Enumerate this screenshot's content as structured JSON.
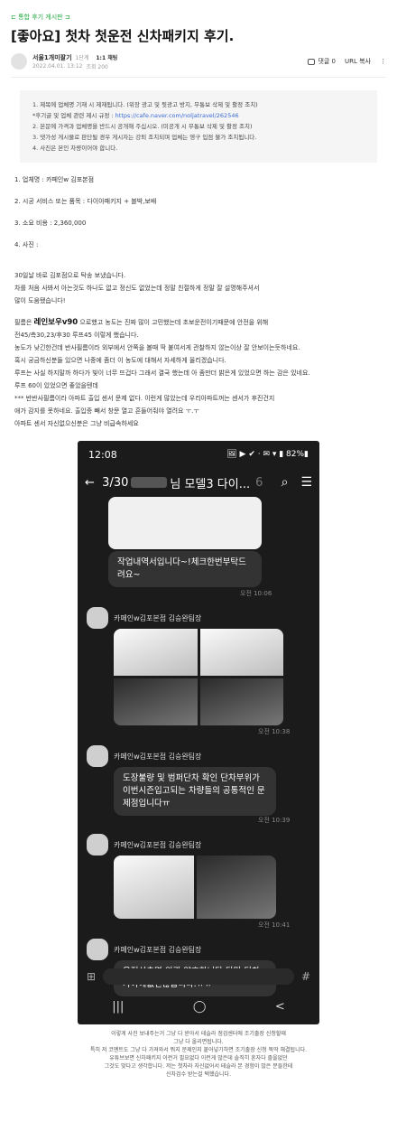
{
  "header": {
    "board_link": "⊏ 통합 후기 게시판 ⊐",
    "title": "[좋아요] 첫차 첫운전 신차패키지 후기."
  },
  "author": {
    "name": "서울1개미팔기",
    "level": "1단계",
    "chat": "1:1 채팅",
    "date": "2022.04.01. 13:12",
    "views": "조회 200"
  },
  "actions": {
    "comments": "댓글 0",
    "url": "URL 복사",
    "more": "⋮"
  },
  "notice": {
    "lines": [
      "1. 제목에 업체명 기재 시 제재됩니다. (위장 광고 및 뒷광고 방지, 무통보 삭제 및 활정 조치)",
      "*후기글 및 업체 관련 제시 규정 : ",
      "2. 본문에 가격과 업체명을 반드시 공개해 주십시오. (미공개 시 무통보 삭제 및 활정 조치)",
      "3. 댓가성 게시물로 판단될 경우 게시자는 강퇴 조치되며 업체는 영구 입점 불가 조치됩니다.",
      "4. 사진은 본인 차량이어야 합니다."
    ],
    "link": "https://cafe.naver.com/noljatravel/262546"
  },
  "body": {
    "items": [
      "1. 업체명 :  카페인w 김포본점",
      "2. 시공 서비스 또는 품목 :  다이아패키지 + 블박,보배",
      "3. 소요 비용 :  2,360,000",
      "4. 사진 :"
    ],
    "para1": [
      " 30일날 바로 김포점으로 탁송 보냈습니다.",
      "차를 처음 사봐서 아는것도 하나도 없고 정신도 없었는데 정말 친절하게 정말 잘 설명해주셔서",
      "많이 도움됐습니다!"
    ],
    "rain_prefix": "필름은 ",
    "rain_name": "레인보우v90",
    "rain_suffix": " 으로했고 농도는 진짜 많이 고민했는데 초보운전이기때문에 안전을 위해",
    "para2": [
      "전45/측30,23/후30 루프45 이렇게 했습니다.",
      "농도가 낮긴한건데 반사필름이라 외부에서 안쪽을 볼때 딱 붙여서게 관찰하지 않는이상 잘 안보이는듯하네요.",
      "혹시 궁금하신분들 있으면 나중에 좀더 이 농도에 대해서 자세하게 올리겠습니다.",
      "루프는 사실 하지말까 하다가 빛이 너무 뜨겁다 그래서 결국 했는데 아 좀만더 밝은게 있었으면 하는 감은 있네요.",
      "루프 60이 있었으면 좋았을텐데"
    ],
    "para3": [
      "*** 반반사필름이라 아파트 출입 센서 문제 없다. 이런게 많았는데 우리아파트꺼는 센서가 후진건지",
      "  애가 감지를 못하네요. 출입증 빼서 창문 열고 흔들어줘야 열려요 ㅜ.ㅜ",
      "아파트 센서 자신없으신분은 그냥 비급속하세요"
    ]
  },
  "phone": {
    "time": "12:08",
    "status_icons": "🖼 ▶ ✔ · ✉ ▾ ▮ 82%▮",
    "chat_title_a": "3/30",
    "chat_title_b": "님 모델3 다이...",
    "chat_count": "6",
    "msg1": "작업내역서입니다~!체크한번부탁드려요~",
    "time1": "오전 10:06",
    "sender": "카페인w김포본점 김승완팀장",
    "time2": "오전 10:38",
    "msg2": "도장불량 및 범퍼단차  확인 단차부위가  이번시즌입고되는 차량들의 공통적인 문제점입니다ㅠ",
    "time3": "오전 10:39",
    "time4": "오전 10:41",
    "msg3": "운전석측면 외관 양호합니다 다만 단차가아예없진않습니다.ㅠㅠ",
    "nav": [
      "|||",
      "◯",
      "<"
    ]
  },
  "caption": [
    "이렇게 사진 보내주는거 그냥 다 받아서 테슬라 점검센터에 조기출장 신청할때",
    "그냥 다 올리면됩니다.",
    "특히 저 코멘트도 그냥 다 가져와서 뭐지 문제인지 붙어넣기하면 조기출장 신청 뚝딱 해결됩니다.",
    "유튜브보면 신차패키지 이런거 필요없다 이런게 많은데 솔직히 혼자다 졸을없던",
    "그것도 맞다고 생각합니다. 저는 첫차라 자신없어서 테슬라 본 경험이 많은 분들한테",
    "신차검수 받는걸 택했습니다."
  ]
}
